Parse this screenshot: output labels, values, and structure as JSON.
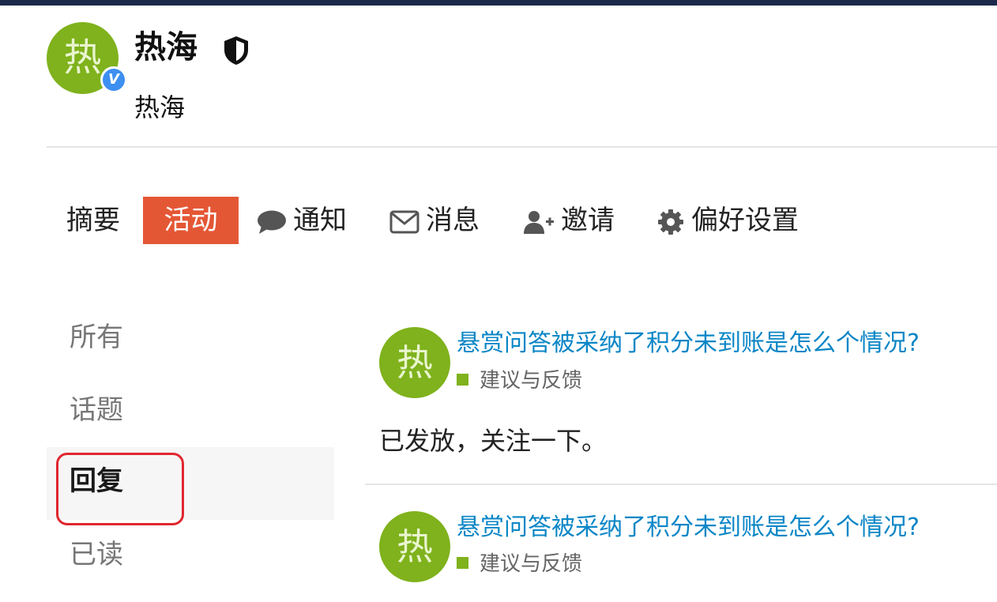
{
  "profile": {
    "avatar_letter": "热",
    "verified_badge": "V",
    "name": "热海",
    "username": "热海"
  },
  "nav": {
    "summary": "摘要",
    "activity": "活动",
    "notifications": "通知",
    "messages": "消息",
    "invite": "邀请",
    "preferences": "偏好设置"
  },
  "filters": {
    "all": "所有",
    "topics": "话题",
    "replies": "回复",
    "read": "已读"
  },
  "posts": [
    {
      "avatar_letter": "热",
      "title": "悬赏问答被采纳了积分未到账是怎么个情况?",
      "category": "建议与反馈",
      "excerpt": "已发放，关注一下。"
    },
    {
      "avatar_letter": "热",
      "title": "悬赏问答被采纳了积分未到账是怎么个情况?",
      "category": "建议与反馈"
    }
  ],
  "colors": {
    "accent": "#e45735",
    "link": "#0a86c6",
    "category": "#7fb21c",
    "highlight": "#e0272f",
    "topbar": "#1b2a4b"
  }
}
